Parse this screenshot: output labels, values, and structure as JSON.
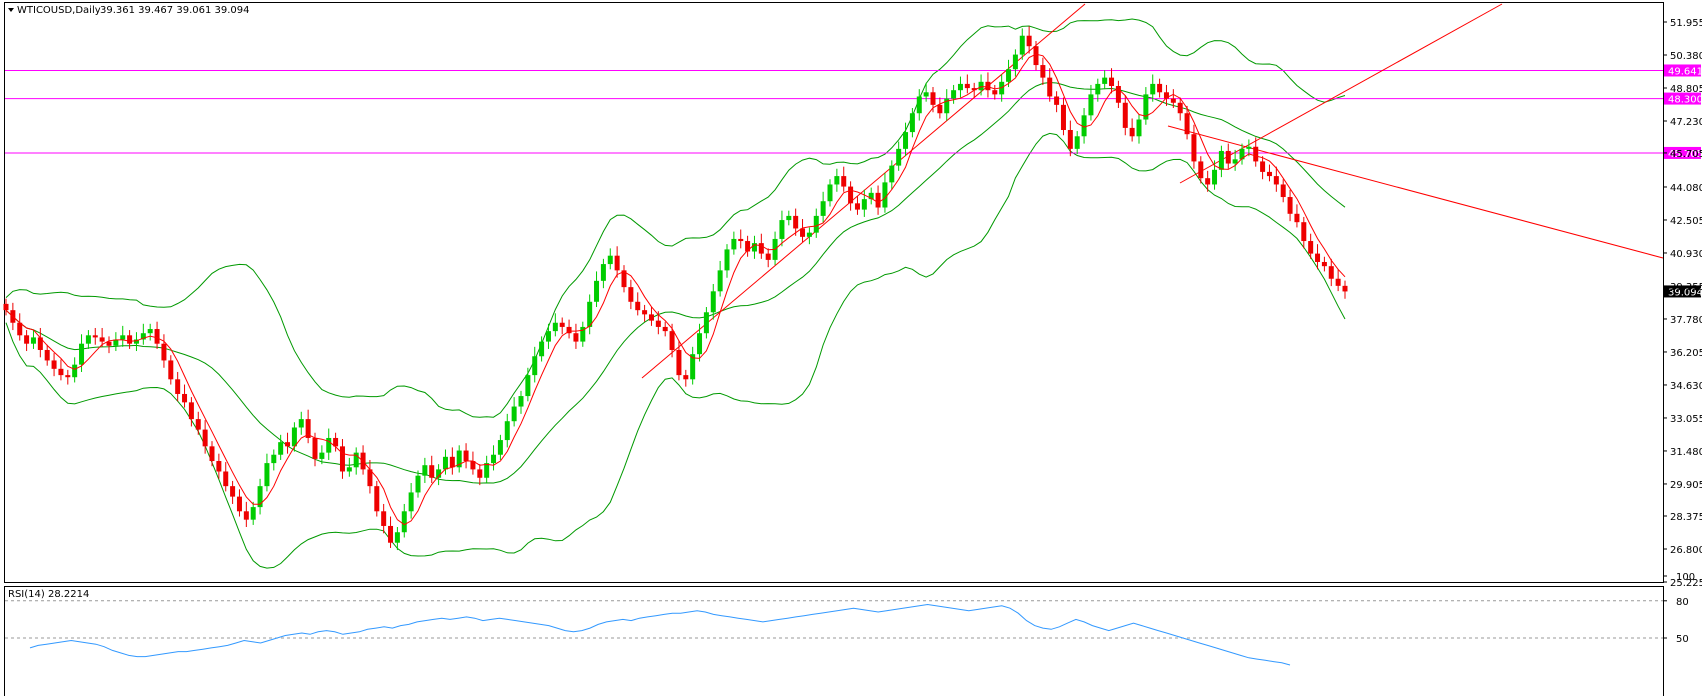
{
  "main_panel": {
    "symbol_label": "WTICOUSD,Daily",
    "ohlc_label": "39.361 39.467 39.061 39.094",
    "price_ticks": [
      "51.955",
      "50.380",
      "48.805",
      "47.230",
      "45.705",
      "44.080",
      "42.505",
      "40.930",
      "39.355",
      "37.780",
      "36.205",
      "34.630",
      "33.055",
      "31.480",
      "29.905",
      "28.375",
      "26.800",
      "25.225"
    ],
    "current_price_label": "39.094"
  },
  "rsi_panel": {
    "label": "RSI(14) 28.2214",
    "ticks": [
      "100",
      "80",
      "50"
    ]
  },
  "chart_data": [
    {
      "type": "candlestick",
      "title": "WTICOUSD,Daily",
      "ylim": [
        25.225,
        52.5
      ],
      "grid": false,
      "horizontal_levels": [
        {
          "value": 49.641,
          "label": "49.641",
          "color": "#ff00ff"
        },
        {
          "value": 48.3,
          "label": "48.300",
          "color": "#ff00ff"
        },
        {
          "value": 45.705,
          "label": "45.705",
          "color": "#ff00ff"
        }
      ],
      "overlays": [
        "Bollinger Bands (upper/middle/lower)",
        "moving average"
      ],
      "colors": {
        "up": "#00cc00",
        "down": "#ee0000",
        "bands": "#009900",
        "ma": "#ff0000",
        "levels": "#ff00ff",
        "trendlines": "#ff0000"
      },
      "closes": [
        38.2,
        37.6,
        37.0,
        36.6,
        36.9,
        36.3,
        35.8,
        35.4,
        35.1,
        35.0,
        35.6,
        36.6,
        37.0,
        36.9,
        36.7,
        36.5,
        36.8,
        37.0,
        36.6,
        36.8,
        37.1,
        37.3,
        36.6,
        35.8,
        34.9,
        34.2,
        33.8,
        33.0,
        32.5,
        31.7,
        31.0,
        30.5,
        29.8,
        29.3,
        28.6,
        28.2,
        28.8,
        29.8,
        30.9,
        31.3,
        31.9,
        31.7,
        32.6,
        33.0,
        32.1,
        31.1,
        31.4,
        32.1,
        31.7,
        30.5,
        30.7,
        31.4,
        30.6,
        29.8,
        28.6,
        27.9,
        27.1,
        27.6,
        28.6,
        29.5,
        30.3,
        30.8,
        30.2,
        30.6,
        31.2,
        30.7,
        31.5,
        31.0,
        30.6,
        30.2,
        30.9,
        31.3,
        32.0,
        32.9,
        33.6,
        34.1,
        35.1,
        36.0,
        36.7,
        37.2,
        37.6,
        37.4,
        37.1,
        36.7,
        37.4,
        38.6,
        39.6,
        40.4,
        40.8,
        40.1,
        39.3,
        38.6,
        38.2,
        38.0,
        37.7,
        37.4,
        37.2,
        36.3,
        35.1,
        34.9,
        36.1,
        37.1,
        38.1,
        39.1,
        40.1,
        41.1,
        41.6,
        41.5,
        41.0,
        41.4,
        40.9,
        40.6,
        41.6,
        42.5,
        42.7,
        42.1,
        41.7,
        41.9,
        42.7,
        43.4,
        44.2,
        44.6,
        44.1,
        43.3,
        43.0,
        43.5,
        43.8,
        43.1,
        44.3,
        45.1,
        45.9,
        46.7,
        47.6,
        48.4,
        48.6,
        48.0,
        47.6,
        48.3,
        48.7,
        49.0,
        48.8,
        48.7,
        49.1,
        48.7,
        48.5,
        49.1,
        49.7,
        50.4,
        51.3,
        50.8,
        49.9,
        49.3,
        48.4,
        48.0,
        46.8,
        45.9,
        46.5,
        47.5,
        48.5,
        49.0,
        49.3,
        48.9,
        48.1,
        46.9,
        46.5,
        47.3,
        48.5,
        49.0,
        48.6,
        48.3,
        48.1,
        47.6,
        46.6,
        45.3,
        44.5,
        44.2,
        44.9,
        45.8,
        45.2,
        45.4,
        45.9,
        46.0,
        45.3,
        44.8,
        44.6,
        44.2,
        43.6,
        42.8,
        42.4,
        41.5,
        40.9,
        40.5,
        40.3,
        39.7,
        39.361,
        39.094
      ],
      "rsi": [
        42,
        44,
        45,
        46,
        47,
        48,
        47,
        46,
        45,
        43,
        40,
        38,
        36,
        35,
        35,
        36,
        37,
        38,
        39,
        39,
        40,
        41,
        42,
        43,
        44,
        46,
        48,
        47,
        46,
        48,
        50,
        52,
        53,
        54,
        53,
        55,
        56,
        55,
        53,
        54,
        55,
        57,
        58,
        59,
        58,
        60,
        61,
        63,
        64,
        65,
        66,
        65,
        66,
        67,
        66,
        64,
        65,
        66,
        65,
        64,
        63,
        62,
        61,
        60,
        58,
        56,
        55,
        56,
        58,
        61,
        63,
        64,
        65,
        64,
        66,
        67,
        68,
        69,
        70,
        70,
        71,
        72,
        71,
        69,
        68,
        67,
        66,
        65,
        64,
        63,
        64,
        65,
        66,
        67,
        68,
        69,
        70,
        71,
        72,
        73,
        74,
        73,
        72,
        71,
        72,
        73,
        74,
        75,
        76,
        77,
        76,
        75,
        74,
        73,
        72,
        73,
        74,
        75,
        76,
        74,
        70,
        64,
        60,
        58,
        57,
        59,
        62,
        65,
        63,
        60,
        58,
        56,
        58,
        60,
        62,
        60,
        58,
        56,
        54,
        52,
        50,
        48,
        46,
        44,
        42,
        40,
        38,
        36,
        34,
        33,
        32,
        31,
        30,
        28.2214
      ]
    }
  ]
}
